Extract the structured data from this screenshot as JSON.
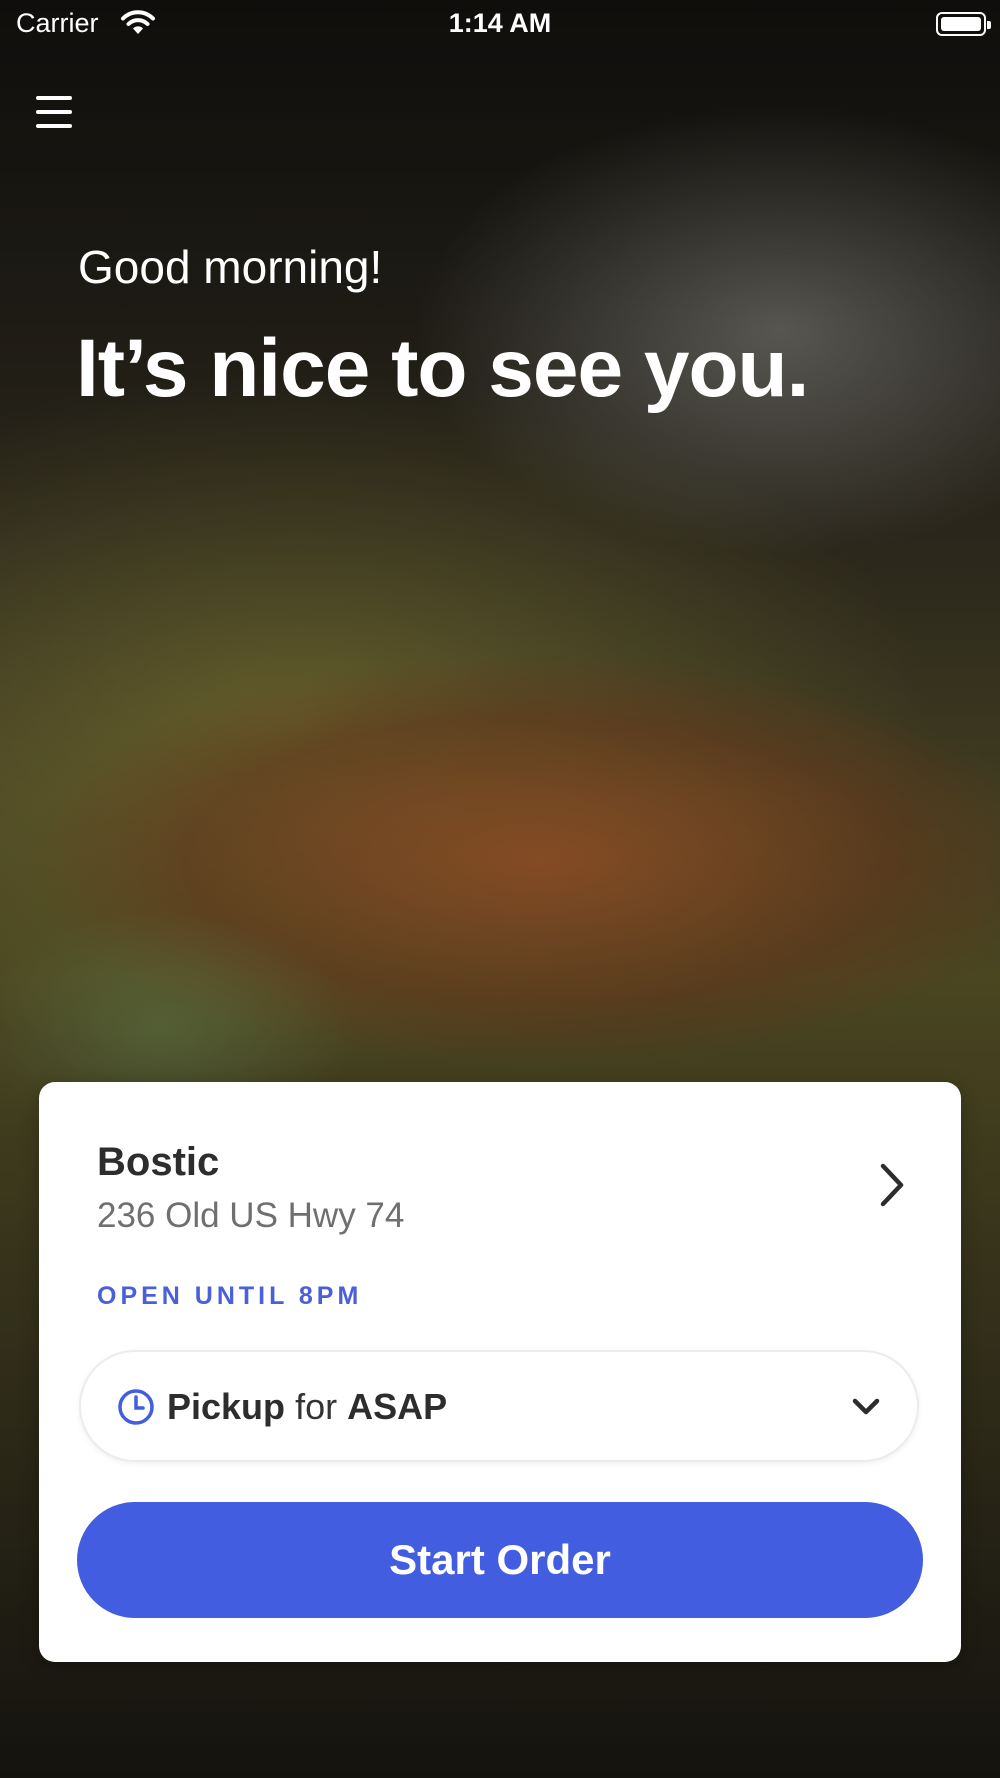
{
  "status_bar": {
    "carrier": "Carrier",
    "time": "1:14 AM"
  },
  "menu": {
    "icon": "hamburger-menu-icon"
  },
  "hero": {
    "greeting": "Good morning!",
    "headline": "It’s nice to see you.",
    "background_image": "grilled-fish-photo"
  },
  "location_card": {
    "store_name": "Bostic",
    "address": "236 Old US Hwy 74",
    "hours_status": "OPEN UNTIL 8PM",
    "chevron_icon": "chevron-right-icon"
  },
  "order_type": {
    "mode": "Pickup",
    "connector": "for",
    "time": "ASAP",
    "icon": "clock-icon",
    "dropdown_icon": "chevron-down-icon"
  },
  "cta": {
    "label": "Start Order"
  },
  "colors": {
    "accent": "#425ddf",
    "hours_status": "#4a5fd8",
    "card_background": "#ffffff"
  }
}
